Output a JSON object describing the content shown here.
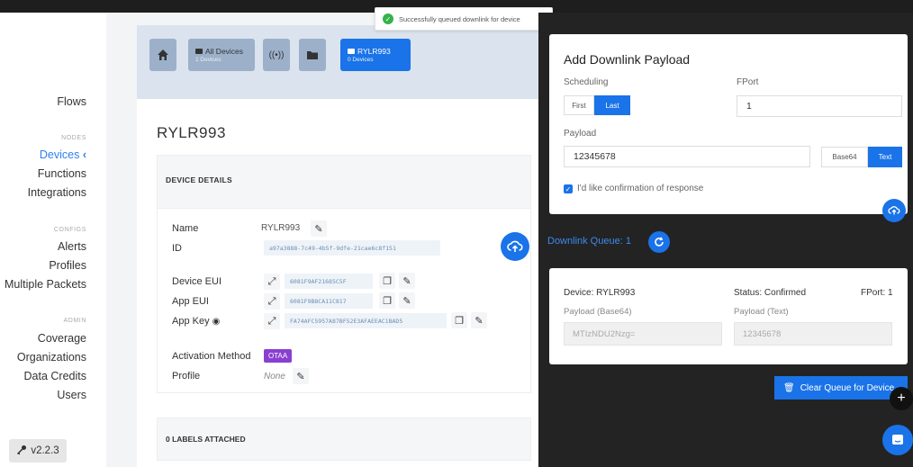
{
  "toast": {
    "message": "Successfully queued downlink for device"
  },
  "sidebar": {
    "flows": "Flows",
    "nodes_section": "NODES",
    "devices": "Devices",
    "functions": "Functions",
    "integrations": "Integrations",
    "config_section": "CONFIGS",
    "alerts": "Alerts",
    "profiles": "Profiles",
    "multiple_packets": "Multiple Packets",
    "admin_section": "ADMIN",
    "coverage": "Coverage",
    "organizations": "Organizations",
    "data_credits": "Data Credits",
    "users": "Users",
    "version": "v2.2.3"
  },
  "breadcrumbs": {
    "all_devices": "All Devices",
    "all_devices_count": "1 Devices",
    "current": "RYLR993",
    "current_count": "0 Devices"
  },
  "device": {
    "title": "RYLR993",
    "details_header": "DEVICE DETAILS",
    "name_label": "Name",
    "name_value": "RYLR993",
    "id_label": "ID",
    "id_value": "a97a3888-7c49-4b5f-9dfe-21cae6c8f151",
    "dev_eui_label": "Device EUI",
    "dev_eui_value": "6081F9AF21685C5F",
    "app_eui_label": "App EUI",
    "app_eui_value": "6081F9B8CA11C817",
    "app_key_label": "App Key",
    "app_key_value": "FA74AFC5957A87BF52E3AFAEEAC1BAD5",
    "activation_label": "Activation Method",
    "activation_value": "OTAA",
    "profile_label": "Profile",
    "profile_value": "None",
    "labels_header": "0 LABELS ATTACHED"
  },
  "downlink": {
    "title": "Add Downlink Payload",
    "scheduling_label": "Scheduling",
    "first": "First",
    "last": "Last",
    "fport_label": "FPort",
    "fport_value": "1",
    "payload_label": "Payload",
    "payload_value": "12345678",
    "base64": "Base64",
    "text": "Text",
    "confirm_label": "I'd like confirmation of response"
  },
  "queue": {
    "label": "Downlink Queue: 1",
    "device": "Device: RYLR993",
    "status": "Status: Confirmed",
    "fport": "FPort: 1",
    "payload_b64_label": "Payload (Base64)",
    "payload_b64_value": "MTIzNDU2Nzg=",
    "payload_text_label": "Payload (Text)",
    "payload_text_value": "12345678",
    "clear_button": "Clear Queue for Device"
  }
}
